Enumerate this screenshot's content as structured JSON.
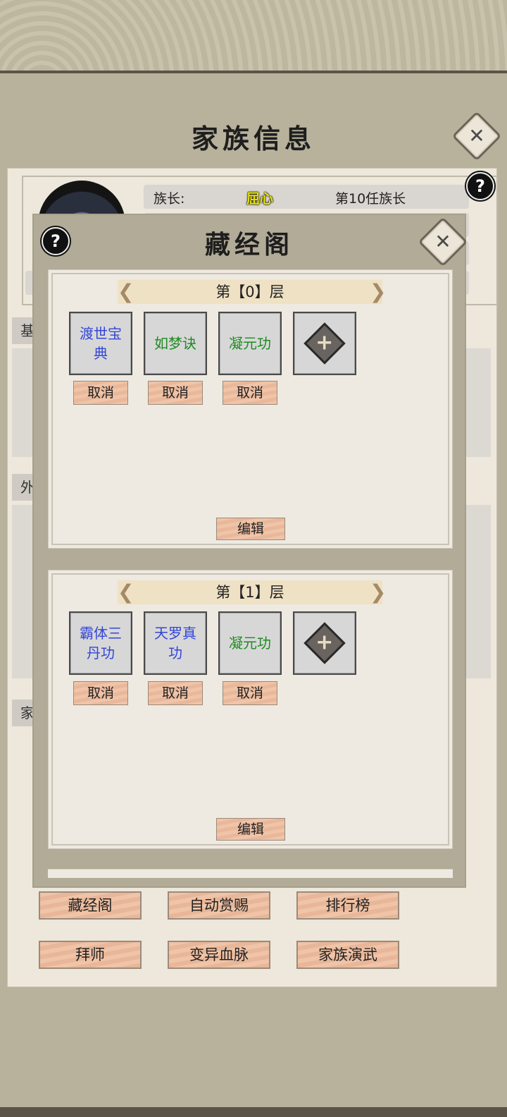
{
  "page": {
    "title": "家族信息",
    "close_label": "✕",
    "help_label": "?"
  },
  "family": {
    "leader_label": "族长:",
    "leader_name": "屈心",
    "leader_generation": "第10任族长",
    "side_tabs": [
      "基",
      "外",
      "家"
    ]
  },
  "bottom_buttons": [
    "藏经阁",
    "自动赏赐",
    "排行榜",
    "拜师",
    "变异血脉",
    "家族演武"
  ],
  "dialog": {
    "title": "藏经阁",
    "help_label": "?",
    "close_label": "✕",
    "floors": [
      {
        "label": "第【0】层",
        "slots": [
          {
            "name": "渡世宝典",
            "color": "#3346d6"
          },
          {
            "name": "如梦诀",
            "color": "#1f8a1f"
          },
          {
            "name": "凝元功",
            "color": "#1f8a1f"
          }
        ],
        "cancel_label": "取消",
        "edit_label": "编辑"
      },
      {
        "label": "第【1】层",
        "slots": [
          {
            "name": "霸体三丹功",
            "color": "#3346d6"
          },
          {
            "name": "天罗真功",
            "color": "#3346d6"
          },
          {
            "name": "凝元功",
            "color": "#1f8a1f"
          }
        ],
        "cancel_label": "取消",
        "edit_label": "编辑"
      }
    ]
  },
  "colors": {
    "background": "#b8b29c",
    "panel": "#ede7dc",
    "button_peach": "#f0c4a8",
    "skill_blue": "#3346d6",
    "skill_green": "#1f8a1f",
    "leader_name_yellow": "#e8e400"
  },
  "icons": {
    "close": "close-icon",
    "help": "help-icon",
    "add": "plus-diamond-icon",
    "arrow_left": "chevron-left-icon",
    "arrow_right": "chevron-right-icon"
  }
}
